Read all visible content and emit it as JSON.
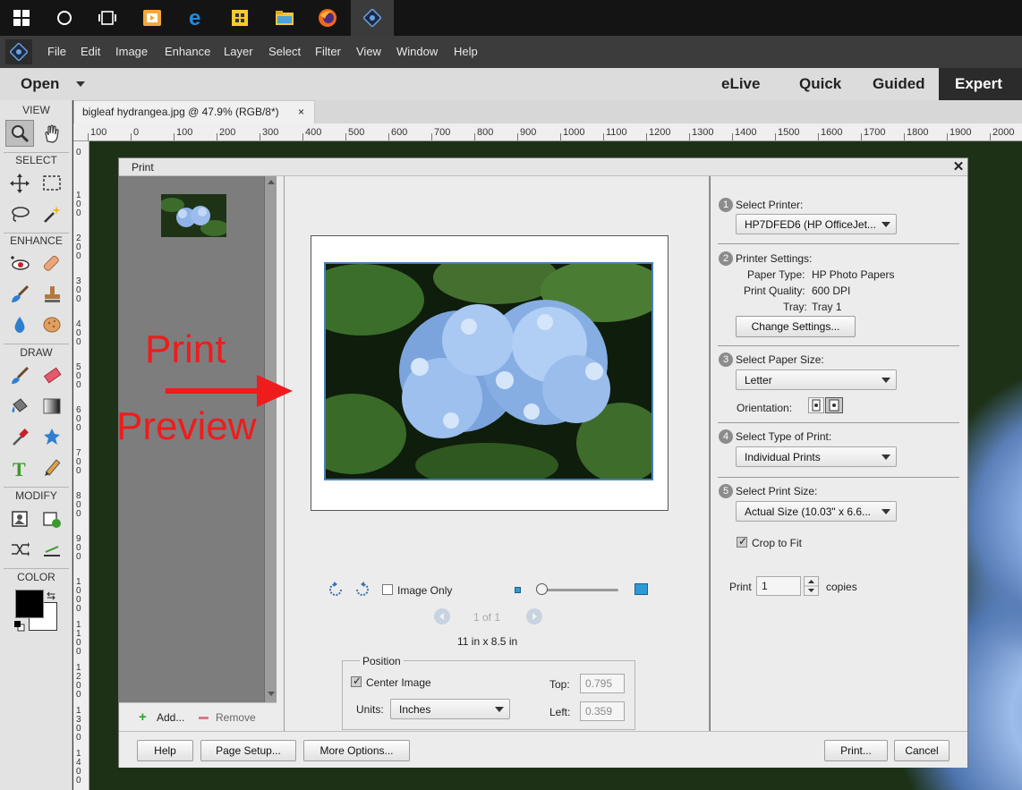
{
  "taskbar": {
    "icons": [
      "windows-start-icon",
      "cortana-icon",
      "task-view-icon",
      "video-editor-icon",
      "edge-icon",
      "file-explorer-icon",
      "folder-icon",
      "firefox-icon",
      "photoshop-elements-icon"
    ]
  },
  "menu": {
    "items": [
      "File",
      "Edit",
      "Image",
      "Enhance",
      "Layer",
      "Select",
      "Filter",
      "View",
      "Window",
      "Help"
    ]
  },
  "modebar": {
    "open": "Open",
    "modes": [
      "eLive",
      "Quick",
      "Guided",
      "Expert"
    ],
    "active": "Expert"
  },
  "toolbox": {
    "sections": [
      "VIEW",
      "SELECT",
      "ENHANCE",
      "DRAW",
      "MODIFY",
      "COLOR"
    ]
  },
  "document": {
    "tab_title": "bigleaf hydrangea.jpg @ 47.9% (RGB/8*)",
    "close": "×"
  },
  "ruler": {
    "h_labels": [
      "100",
      "0",
      "100",
      "200",
      "300",
      "400",
      "500",
      "600",
      "700",
      "800",
      "900",
      "1000",
      "1100",
      "1200",
      "1300",
      "1400",
      "1500",
      "1600",
      "1700",
      "1800",
      "1900",
      "2000"
    ],
    "v_labels": [
      "0",
      "1\n0\n0",
      "2\n0\n0",
      "3\n0\n0",
      "4\n0\n0",
      "5\n0\n0",
      "6\n0\n0",
      "7\n0\n0",
      "8\n0\n0",
      "9\n0\n0",
      "1\n0\n0\n0",
      "1\n1\n0\n0",
      "1\n2\n0\n0",
      "1\n3\n0\n0",
      "1\n4\n0\n0"
    ]
  },
  "annotation": {
    "line1": "Print",
    "line2": "Preview",
    "color": "#ee1c1c"
  },
  "dialog": {
    "title": "Print",
    "close": "✕",
    "add": "Add...",
    "remove": "Remove",
    "image_only": "Image Only",
    "page_nav": "1 of 1",
    "paper_dims": "11 in x 8.5 in",
    "position": {
      "legend": "Position",
      "center_image": "Center Image",
      "units_label": "Units:",
      "units_value": "Inches",
      "top_label": "Top:",
      "top_value": "0.795",
      "left_label": "Left:",
      "left_value": "0.359"
    },
    "steps": {
      "s1": {
        "num": "1",
        "label": "Select Printer:",
        "value": "HP7DFED6 (HP OfficeJet..."
      },
      "s2": {
        "num": "2",
        "label": "Printer Settings:",
        "paper_type_label": "Paper Type:",
        "paper_type": "HP Photo Papers",
        "quality_label": "Print Quality:",
        "quality": "600 DPI",
        "tray_label": "Tray:",
        "tray": "Tray 1",
        "change_button": "Change Settings..."
      },
      "s3": {
        "num": "3",
        "label": "Select Paper Size:",
        "value": "Letter",
        "orientation_label": "Orientation:"
      },
      "s4": {
        "num": "4",
        "label": "Select Type of Print:",
        "value": "Individual Prints"
      },
      "s5": {
        "num": "5",
        "label": "Select Print Size:",
        "value": "Actual Size (10.03\" x 6.6...",
        "crop": "Crop to Fit"
      }
    },
    "copies": {
      "label": "Print",
      "value": "1",
      "suffix": "copies"
    },
    "buttons": {
      "help": "Help",
      "page_setup": "Page Setup...",
      "more_options": "More Options...",
      "print": "Print...",
      "cancel": "Cancel"
    }
  }
}
